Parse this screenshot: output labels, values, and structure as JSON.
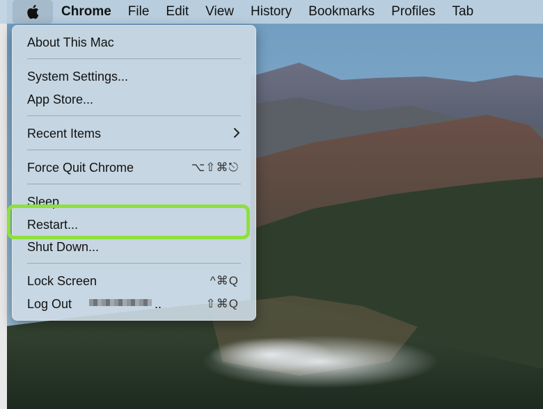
{
  "menubar": {
    "apple_icon": "apple-logo-icon",
    "items": [
      "Chrome",
      "File",
      "Edit",
      "View",
      "History",
      "Bookmarks",
      "Profiles",
      "Tab"
    ]
  },
  "apple_menu": {
    "about": "About This Mac",
    "system_settings": "System Settings...",
    "app_store": "App Store...",
    "recent_items": "Recent Items",
    "force_quit": "Force Quit Chrome",
    "force_quit_shortcut": "⌥⇧⌘⎋",
    "sleep": "Sleep",
    "restart": "Restart...",
    "shut_down": "Shut Down...",
    "lock_screen": "Lock Screen",
    "lock_screen_shortcut": "^⌘Q",
    "log_out": "Log Out",
    "log_out_suffix": "..",
    "log_out_shortcut": "⇧⌘Q"
  },
  "colors": {
    "highlight": "#8ee03c",
    "menubar": "#bed2e1"
  }
}
